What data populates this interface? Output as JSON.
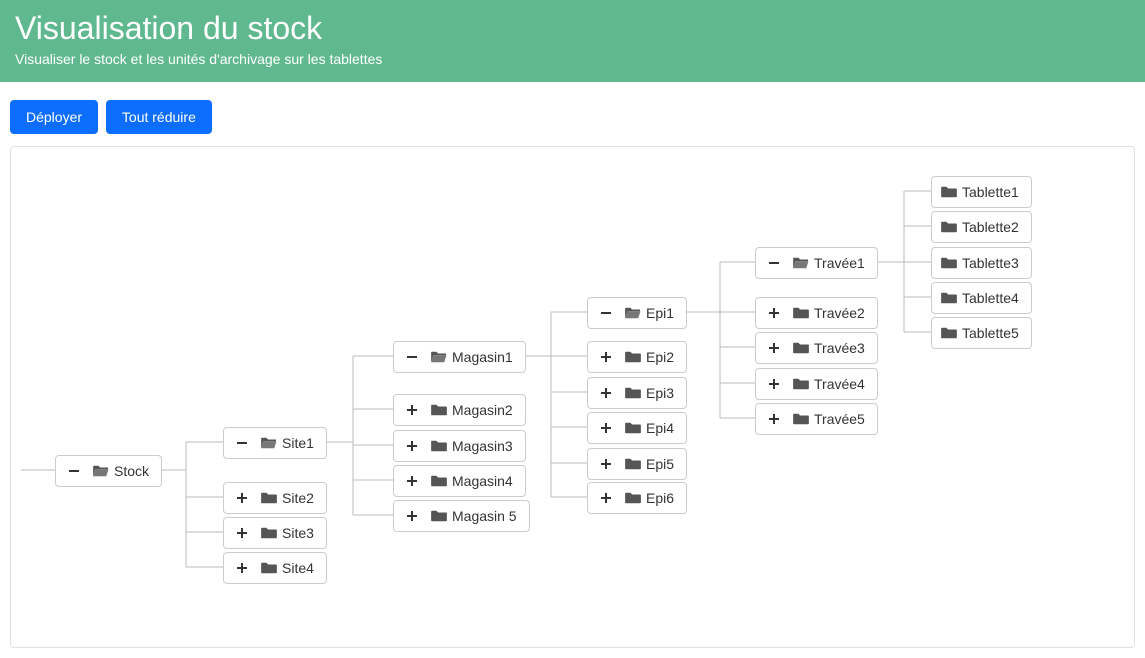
{
  "header": {
    "title": "Visualisation du stock",
    "subtitle": "Visualiser le stock et les unités d'archivage sur les tablettes"
  },
  "toolbar": {
    "deploy": "Déployer",
    "collapse_all": "Tout réduire"
  },
  "tree": {
    "root": "Stock",
    "sites": [
      "Site1",
      "Site2",
      "Site3",
      "Site4"
    ],
    "magasins": [
      "Magasin1",
      "Magasin2",
      "Magasin3",
      "Magasin4",
      "Magasin 5"
    ],
    "epis": [
      "Epi1",
      "Epi2",
      "Epi3",
      "Epi4",
      "Epi5",
      "Epi6"
    ],
    "travees": [
      "Travée1",
      "Travée2",
      "Travée3",
      "Travée4",
      "Travée5"
    ],
    "tablettes": [
      "Tablette1",
      "Tablette2",
      "Tablette3",
      "Tablette4",
      "Tablette5"
    ]
  }
}
